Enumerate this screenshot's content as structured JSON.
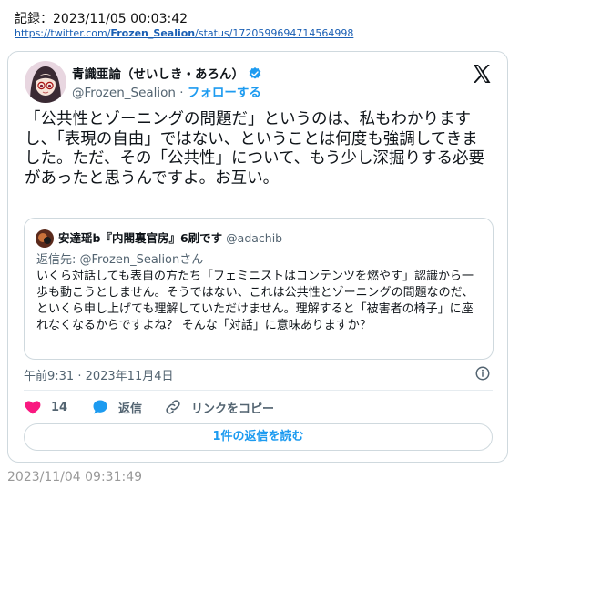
{
  "record": "記録：2023/11/05 00:03:42",
  "link": {
    "prefix": "https://twitter.com/",
    "user": "Frozen_Sealion",
    "suffix": "/status/1720599694714564998"
  },
  "tweet": {
    "author_name": "青識亜論（せいしき・あろん）",
    "handle": "@Frozen_Sealion",
    "separator": "·",
    "follow_label": "フォローする",
    "text": "「公共性とゾーニングの問題だ」というのは、私もわかりますし、「表現の自由」ではない、ということは何度も強調してきました。ただ、その「公共性」について、もう少し深掘りする必要があったと思うんですよ。お互い。",
    "timestamp": "午前9:31 · 2023年11月4日",
    "likes": "14",
    "reply_label": "返信",
    "copy_link_label": "リンクをコピー",
    "read_replies_label": "1件の返信を読む"
  },
  "quote": {
    "author_name": "安達瑶b『内閣裏官房』6刷です",
    "handle": "@adachib",
    "reply_to": "返信先: @Frozen_Sealionさん",
    "text": "いくら対話しても表自の方たち「フェミニストはコンテンツを燃やす」認識から一歩も動こうとしません。そうではない、これは公共性とゾーニングの問題なのだ、といくら申し上げても理解していただけません。理解すると「被害者の椅子」に座れなくなるからですよね？ そんな「対話」に意味ありますか？"
  },
  "footer_time": "2023/11/04 09:31:49",
  "colors": {
    "accent": "#1d9bf0",
    "like": "#f91880",
    "muted": "#536471"
  }
}
